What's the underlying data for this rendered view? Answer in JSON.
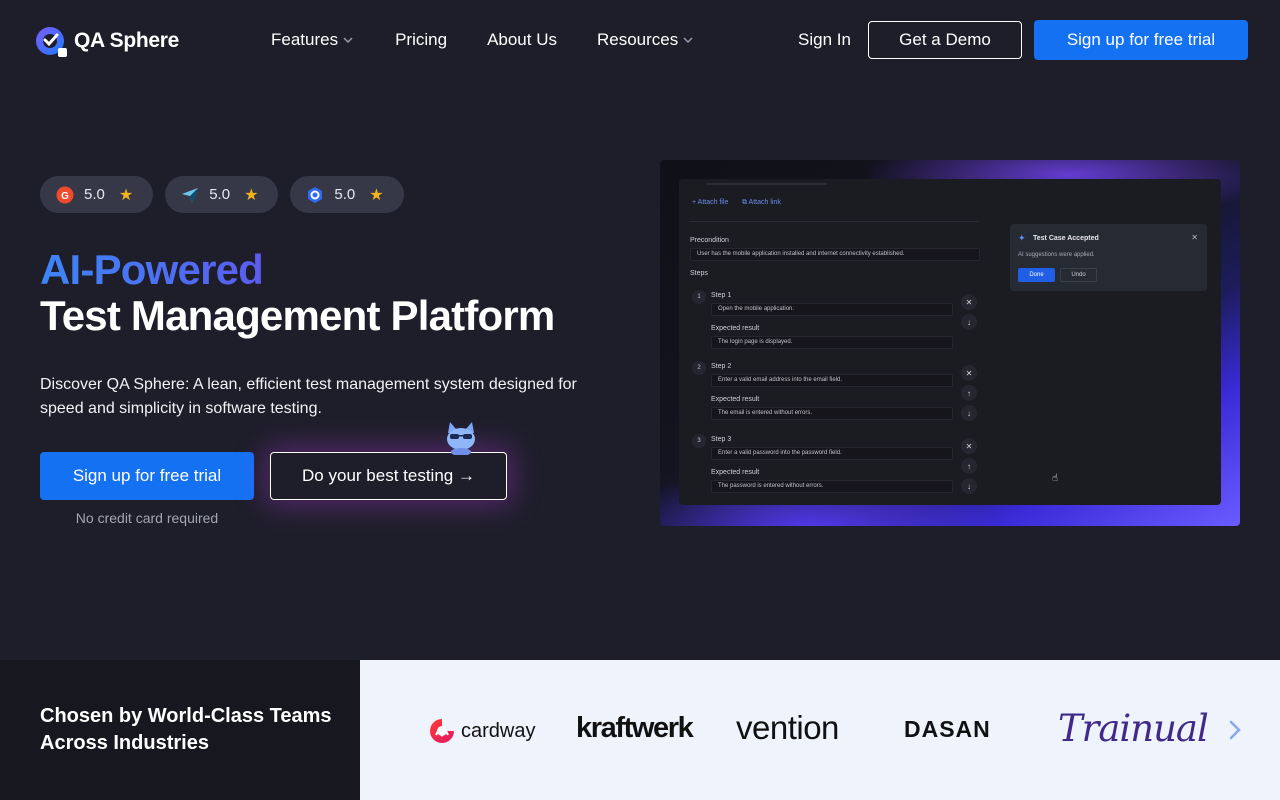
{
  "brand": {
    "name": "QA Sphere",
    "accent": "#1472f2"
  },
  "nav": {
    "features": "Features",
    "pricing": "Pricing",
    "about": "About Us",
    "resources": "Resources",
    "signin": "Sign In",
    "demo": "Get a Demo",
    "trial": "Sign up for free trial"
  },
  "ratings": [
    {
      "icon": "g2-icon",
      "value": "5.0"
    },
    {
      "icon": "capterra-icon",
      "value": "5.0"
    },
    {
      "icon": "getapp-icon",
      "value": "5.0"
    }
  ],
  "hero": {
    "title_accent": "AI-Powered",
    "title_main": "Test Management Platform",
    "lead": "Discover QA Sphere: A lean, efficient test management system designed for speed and simplicity in software testing.",
    "cta_primary": "Sign up for free trial",
    "cta_secondary": "Do your best testing →",
    "note": "No credit card required"
  },
  "preview": {
    "attach_file": "+ Attach file",
    "attach_link": "⧉ Attach link",
    "precondition_label": "Precondition",
    "precondition_value": "User has the mobile application installed and internet connectivity established.",
    "steps_label": "Steps",
    "expected_label": "Expected result",
    "steps": [
      {
        "num": "1",
        "label": "Step 1",
        "action": "Open the mobile application.",
        "expected": "The login page is displayed."
      },
      {
        "num": "2",
        "label": "Step 2",
        "action": "Enter a valid email address into the email field.",
        "expected": "The email is entered without errors."
      },
      {
        "num": "3",
        "label": "Step 3",
        "action": "Enter a valid password into the password field.",
        "expected": "The password is entered without errors."
      }
    ],
    "toast": {
      "title": "Test Case Accepted",
      "message": "AI suggestions were applied.",
      "done": "Done",
      "undo": "Undo"
    }
  },
  "clients": {
    "title": "Chosen by World-Class Teams Across Industries",
    "logos": [
      "cardway",
      "kraftwerk",
      "vention",
      "DASAN",
      "Trainual"
    ]
  }
}
